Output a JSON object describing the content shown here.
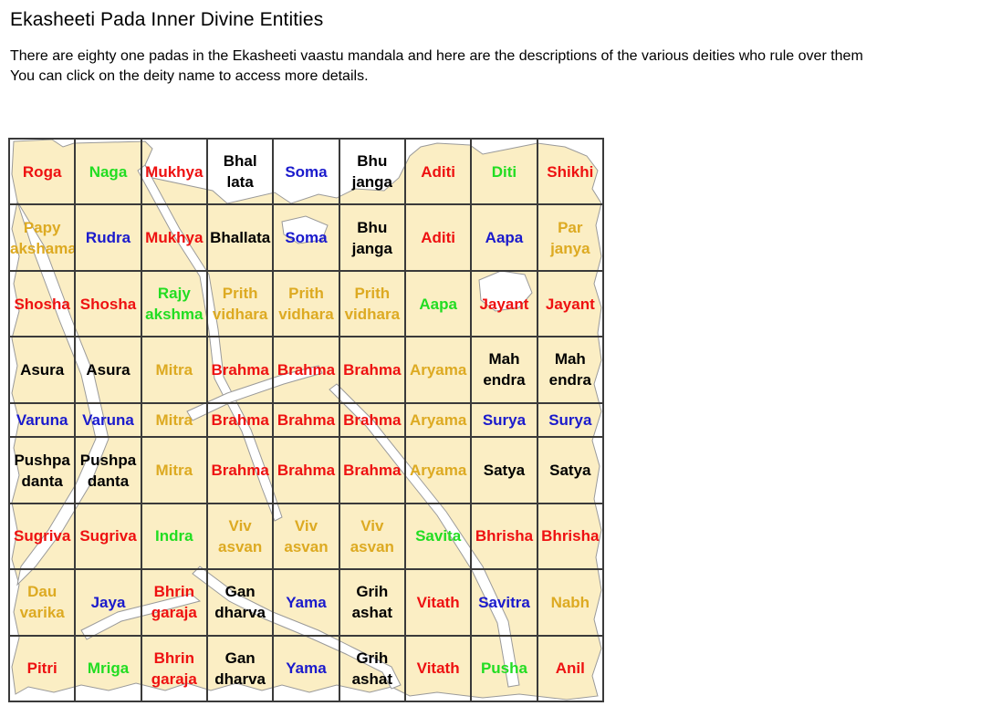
{
  "page": {
    "title": "Ekasheeti Pada Inner Divine Entities",
    "description_line1": "There are eighty one padas in the Ekasheeti vaastu mandala and here are the descriptions of the various deities who rule over them",
    "description_line2": "You can click on the deity name to access more details."
  },
  "colors": {
    "red": "#ee1111",
    "green": "#22dd22",
    "blue": "#1a1acc",
    "black": "#000000",
    "gold": "#ddaa22",
    "map_fill": "#fbeec4",
    "grid_line": "#3a3a3a"
  },
  "grid": {
    "rows": [
      [
        {
          "l1": "Roga",
          "l2": "",
          "color": "red"
        },
        {
          "l1": "Naga",
          "l2": "",
          "color": "green"
        },
        {
          "l1": "Mukhya",
          "l2": "",
          "color": "red"
        },
        {
          "l1": "Bhal",
          "l2": "lata",
          "color": "black"
        },
        {
          "l1": "Soma",
          "l2": "",
          "color": "blue"
        },
        {
          "l1": "Bhu",
          "l2": "janga",
          "color": "black"
        },
        {
          "l1": "Aditi",
          "l2": "",
          "color": "red"
        },
        {
          "l1": "Diti",
          "l2": "",
          "color": "green"
        },
        {
          "l1": "Shikhi",
          "l2": "",
          "color": "red"
        }
      ],
      [
        {
          "l1": "Papy",
          "l2": "akshama",
          "color": "gold"
        },
        {
          "l1": "Rudra",
          "l2": "",
          "color": "blue"
        },
        {
          "l1": "Mukhya",
          "l2": "",
          "color": "red"
        },
        {
          "l1": "Bhallata",
          "l2": "",
          "color": "black"
        },
        {
          "l1": "Soma",
          "l2": "",
          "color": "blue"
        },
        {
          "l1": "Bhu",
          "l2": "janga",
          "color": "black"
        },
        {
          "l1": "Aditi",
          "l2": "",
          "color": "red"
        },
        {
          "l1": "Aapa",
          "l2": "",
          "color": "blue"
        },
        {
          "l1": "Par",
          "l2": "janya",
          "color": "gold"
        }
      ],
      [
        {
          "l1": "Shosha",
          "l2": "",
          "color": "red"
        },
        {
          "l1": "Shosha",
          "l2": "",
          "color": "red"
        },
        {
          "l1": "Rajy",
          "l2": "akshma",
          "color": "green"
        },
        {
          "l1": "Prith",
          "l2": "vidhara",
          "color": "gold"
        },
        {
          "l1": "Prith",
          "l2": "vidhara",
          "color": "gold"
        },
        {
          "l1": "Prith",
          "l2": "vidhara",
          "color": "gold"
        },
        {
          "l1": "Aapa",
          "l2": "",
          "color": "green"
        },
        {
          "l1": "Jayant",
          "l2": "",
          "color": "red"
        },
        {
          "l1": "Jayant",
          "l2": "",
          "color": "red"
        }
      ],
      [
        {
          "l1": "Asura",
          "l2": "",
          "color": "black"
        },
        {
          "l1": "Asura",
          "l2": "",
          "color": "black"
        },
        {
          "l1": "Mitra",
          "l2": "",
          "color": "gold"
        },
        {
          "l1": "Brahma",
          "l2": "",
          "color": "red"
        },
        {
          "l1": "Brahma",
          "l2": "",
          "color": "red"
        },
        {
          "l1": "Brahma",
          "l2": "",
          "color": "red"
        },
        {
          "l1": "Aryama",
          "l2": "",
          "color": "gold"
        },
        {
          "l1": "Mah",
          "l2": "endra",
          "color": "black"
        },
        {
          "l1": "Mah",
          "l2": "endra",
          "color": "black"
        }
      ],
      [
        {
          "l1": "Varuna",
          "l2": "",
          "color": "blue"
        },
        {
          "l1": "Varuna",
          "l2": "",
          "color": "blue"
        },
        {
          "l1": "Mitra",
          "l2": "",
          "color": "gold"
        },
        {
          "l1": "Brahma",
          "l2": "",
          "color": "red"
        },
        {
          "l1": "Brahma",
          "l2": "",
          "color": "red"
        },
        {
          "l1": "Brahma",
          "l2": "",
          "color": "red"
        },
        {
          "l1": "Aryama",
          "l2": "",
          "color": "gold"
        },
        {
          "l1": "Surya",
          "l2": "",
          "color": "blue"
        },
        {
          "l1": "Surya",
          "l2": "",
          "color": "blue"
        }
      ],
      [
        {
          "l1": "Pushpa",
          "l2": "danta",
          "color": "black"
        },
        {
          "l1": "Pushpa",
          "l2": "danta",
          "color": "black"
        },
        {
          "l1": "Mitra",
          "l2": "",
          "color": "gold"
        },
        {
          "l1": "Brahma",
          "l2": "",
          "color": "red"
        },
        {
          "l1": "Brahma",
          "l2": "",
          "color": "red"
        },
        {
          "l1": "Brahma",
          "l2": "",
          "color": "red"
        },
        {
          "l1": "Aryama",
          "l2": "",
          "color": "gold"
        },
        {
          "l1": "Satya",
          "l2": "",
          "color": "black"
        },
        {
          "l1": "Satya",
          "l2": "",
          "color": "black"
        }
      ],
      [
        {
          "l1": "Sugriva",
          "l2": "",
          "color": "red"
        },
        {
          "l1": "Sugriva",
          "l2": "",
          "color": "red"
        },
        {
          "l1": "Indra",
          "l2": "",
          "color": "green"
        },
        {
          "l1": "Viv",
          "l2": "asvan",
          "color": "gold"
        },
        {
          "l1": "Viv",
          "l2": "asvan",
          "color": "gold"
        },
        {
          "l1": "Viv",
          "l2": "asvan",
          "color": "gold"
        },
        {
          "l1": "Savita",
          "l2": "",
          "color": "green"
        },
        {
          "l1": "Bhrisha",
          "l2": "",
          "color": "red"
        },
        {
          "l1": "Bhrisha",
          "l2": "",
          "color": "red"
        }
      ],
      [
        {
          "l1": "Dau",
          "l2": "varika",
          "color": "gold"
        },
        {
          "l1": "Jaya",
          "l2": "",
          "color": "blue"
        },
        {
          "l1": "Bhrin",
          "l2": "garaja",
          "color": "red"
        },
        {
          "l1": "Gan",
          "l2": "dharva",
          "color": "black"
        },
        {
          "l1": "Yama",
          "l2": "",
          "color": "blue"
        },
        {
          "l1": "Grih",
          "l2": "ashat",
          "color": "black"
        },
        {
          "l1": "Vitath",
          "l2": "",
          "color": "red"
        },
        {
          "l1": "Savitra",
          "l2": "",
          "color": "blue"
        },
        {
          "l1": "Nabh",
          "l2": "",
          "color": "gold"
        }
      ],
      [
        {
          "l1": "Pitri",
          "l2": "",
          "color": "red"
        },
        {
          "l1": "Mriga",
          "l2": "",
          "color": "green"
        },
        {
          "l1": "Bhrin",
          "l2": "garaja",
          "color": "red"
        },
        {
          "l1": "Gan",
          "l2": "dharva",
          "color": "black"
        },
        {
          "l1": "Yama",
          "l2": "",
          "color": "blue"
        },
        {
          "l1": "Grih",
          "l2": "ashat",
          "color": "black"
        },
        {
          "l1": "Vitath",
          "l2": "",
          "color": "red"
        },
        {
          "l1": "Pusha",
          "l2": "",
          "color": "green"
        },
        {
          "l1": "Anil",
          "l2": "",
          "color": "red"
        }
      ]
    ]
  }
}
